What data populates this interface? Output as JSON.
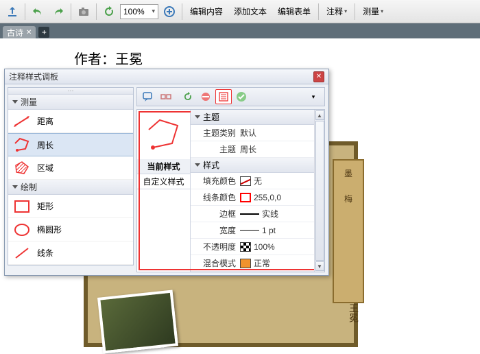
{
  "toolbar": {
    "zoom_value": "100%",
    "menu_edit_content": "编辑内容",
    "menu_add_text": "添加文本",
    "menu_edit_form": "编辑表单",
    "menu_annotate": "注释",
    "menu_measure": "测量"
  },
  "tabs": {
    "items": [
      {
        "label": "古诗"
      }
    ]
  },
  "document": {
    "author_line": "作者：王冕",
    "plaque_char1": "墨",
    "plaque_char2": "梅",
    "signature": "王冕"
  },
  "panel": {
    "title": "注释样式调板",
    "left": {
      "cat_measure": "测量",
      "items_measure": [
        {
          "label": "距离"
        },
        {
          "label": "周长"
        },
        {
          "label": "区域"
        }
      ],
      "cat_draw": "绘制",
      "items_draw": [
        {
          "label": "矩形"
        },
        {
          "label": "椭圆形"
        },
        {
          "label": "线条"
        }
      ]
    },
    "preview": {
      "tab_current": "当前样式",
      "tab_custom": "自定义样式"
    },
    "props": {
      "sec_theme": "主题",
      "row_theme_class": {
        "label": "主题类别",
        "value": "默认"
      },
      "row_theme": {
        "label": "主题",
        "value": "周长"
      },
      "sec_style": "样式",
      "row_fill": {
        "label": "填充颜色",
        "value": "无"
      },
      "row_line_color": {
        "label": "线条颜色",
        "value": "255,0,0"
      },
      "row_border": {
        "label": "边框",
        "value": "实线"
      },
      "row_width": {
        "label": "宽度",
        "value": "1 pt"
      },
      "row_opacity": {
        "label": "不透明度",
        "value": "100%"
      },
      "row_blend": {
        "label": "混合模式",
        "value": "正常"
      }
    }
  }
}
